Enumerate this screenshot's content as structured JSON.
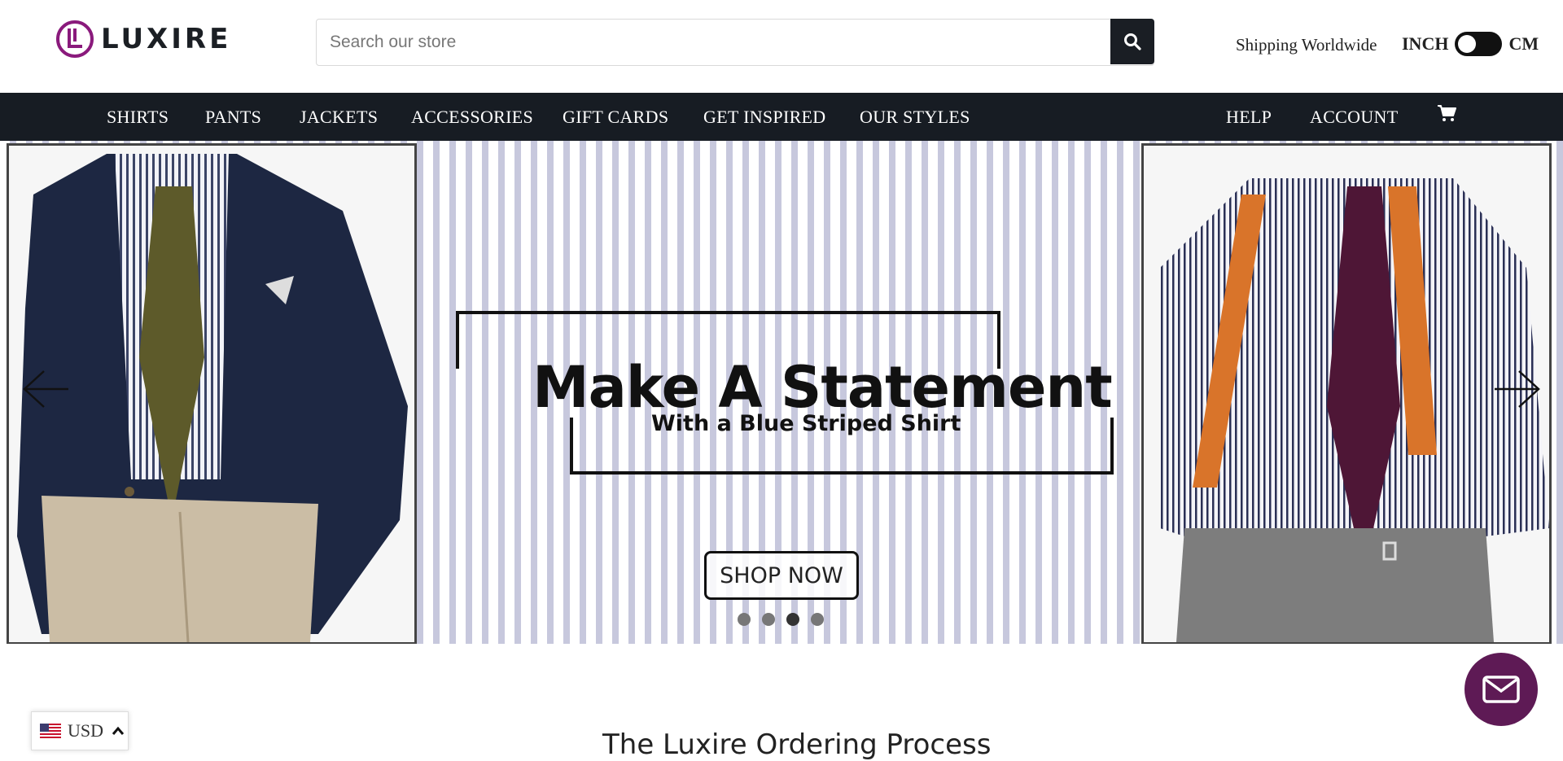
{
  "brand": {
    "name": "LUXIRE",
    "logo_color": "#8a1a7c"
  },
  "search": {
    "placeholder": "Search our store",
    "icon": "search-icon"
  },
  "header": {
    "shipping": "Shipping Worldwide",
    "unit_left": "INCH",
    "unit_right": "CM"
  },
  "nav": {
    "items": [
      "SHIRTS",
      "PANTS",
      "JACKETS",
      "ACCESSORIES",
      "GIFT CARDS",
      "GET INSPIRED",
      "OUR STYLES"
    ],
    "right_items": [
      "HELP",
      "ACCOUNT"
    ],
    "cart_icon": "cart-icon",
    "background": "#171c23"
  },
  "hero": {
    "headline": "Make A Statement",
    "subline": "With a Blue Striped Shirt",
    "cta": "SHOP NOW",
    "slides": 4,
    "active_slide": 3
  },
  "process": {
    "title": "The Luxire Ordering Process"
  },
  "currency": {
    "code": "USD",
    "flag": "us-flag-icon"
  },
  "contact": {
    "icon": "mail-icon",
    "color": "#5e1a55"
  }
}
